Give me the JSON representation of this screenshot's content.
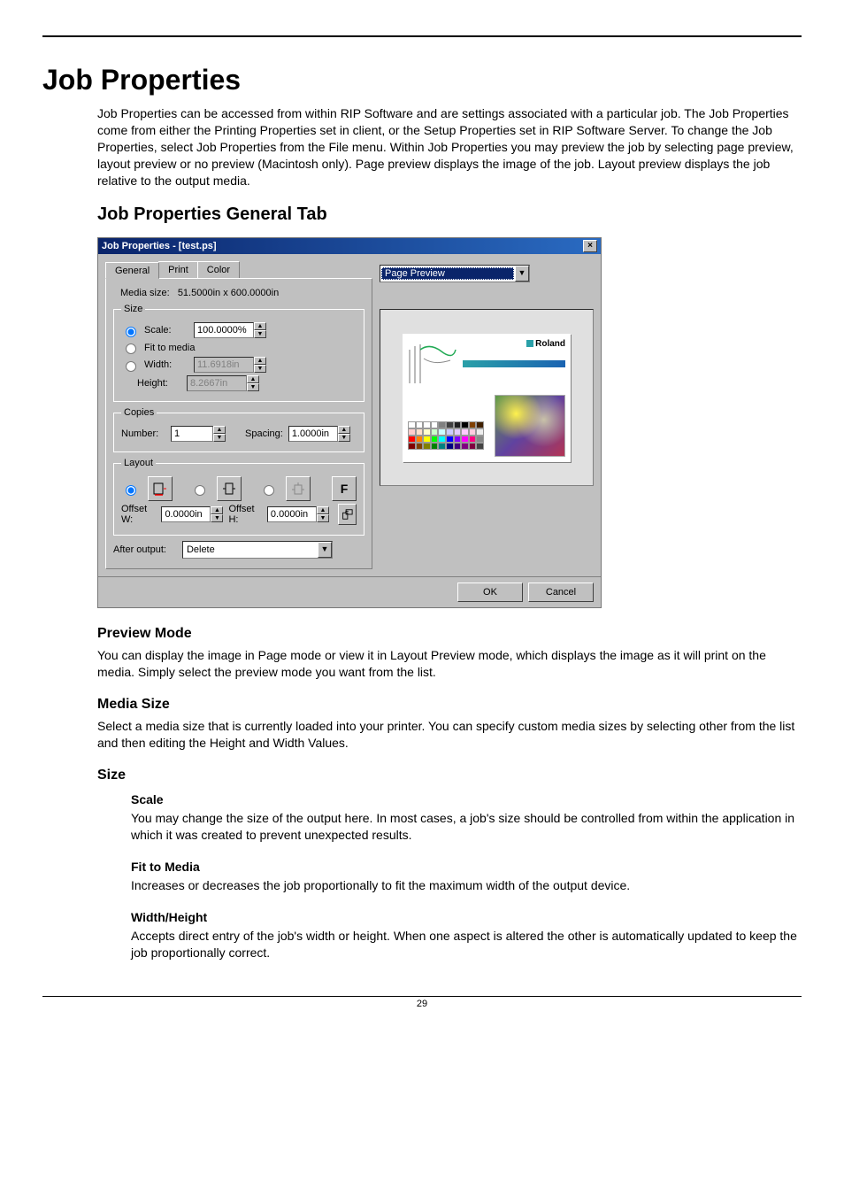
{
  "page": {
    "title": "Job Properties",
    "intro": "Job Properties can be accessed from within RIP Software and are settings associated with a particular job. The Job Properties come from either the Printing Properties set in client, or the Setup Properties set in RIP Software Server. To change the Job Properties, select Job Properties from the File menu. Within Job Properties you may preview the job by selecting page preview, layout preview or no preview (Macintosh only). Page preview displays the image of the job. Layout preview displays the job relative to the output media.",
    "h2": "Job Properties General Tab",
    "preview_mode_h": "Preview Mode",
    "preview_mode_p": "You can display the image in Page mode or view it in Layout Preview mode, which displays the image as it will print on the media. Simply select the preview mode you want from the list.",
    "media_size_h": "Media Size",
    "media_size_p": "Select a media size that is currently loaded into your printer. You can specify custom media sizes by selecting other from the list and then editing the Height and Width Values.",
    "size_h": "Size",
    "scale_h": "Scale",
    "scale_p": "You may change the size of the output here. In most cases, a job's size should be controlled from within the application in which it was created to prevent unexpected results.",
    "fit_h": "Fit to Media",
    "fit_p": "Increases or decreases the job proportionally to fit the maximum width of the output device.",
    "wh_h": "Width/Height",
    "wh_p": "Accepts direct entry of the job's width or height. When one aspect is altered the other is automatically updated to keep the job proportionally correct.",
    "page_number": "29"
  },
  "dialog": {
    "title": "Job Properties - [test.ps]",
    "tabs": {
      "general": "General",
      "print": "Print",
      "color": "Color"
    },
    "media_size_lbl": "Media size:",
    "media_size_val": "51.5000in x 600.0000in",
    "size_legend": "Size",
    "scale_lbl": "Scale:",
    "scale_val": "100.0000%",
    "fit_lbl": "Fit to media",
    "width_lbl": "Width:",
    "width_val": "11.6918in",
    "height_lbl": "Height:",
    "height_val": "8.2667in",
    "copies_legend": "Copies",
    "number_lbl": "Number:",
    "number_val": "1",
    "spacing_lbl": "Spacing:",
    "spacing_val": "1.0000in",
    "layout_legend": "Layout",
    "offset_w_lbl": "Offset W:",
    "offset_w_val": "0.0000in",
    "offset_h_lbl": "Offset H:",
    "offset_h_val": "0.0000in",
    "after_output_lbl": "After output:",
    "after_output_val": "Delete",
    "preview_mode": "Page Preview",
    "fit_page_lbl": "F",
    "brand": "Roland",
    "ok": "OK",
    "cancel": "Cancel"
  }
}
